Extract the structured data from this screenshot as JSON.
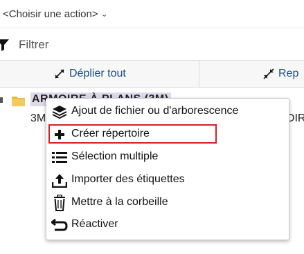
{
  "action_select": {
    "label": "<Choisir une action>"
  },
  "filter": {
    "placeholder": "Filtrer"
  },
  "tree_toolbar": {
    "expand_label": "Déplier tout",
    "collapse_label": "Rep"
  },
  "tree": {
    "node_label": "ARMOIRE À PLANS (3M)",
    "sub_left": "3M",
    "sub_right": "OIR"
  },
  "context_menu": {
    "items": [
      {
        "label": "Ajout de fichier ou d'arborescence",
        "icon": "layers-icon"
      },
      {
        "label": "Créer répertoire",
        "icon": "plus-icon",
        "highlighted": true,
        "highlight_color": "#d41f26"
      },
      {
        "label": "Sélection multiple",
        "icon": "list-icon"
      },
      {
        "label": "Importer des étiquettes",
        "icon": "upload-icon"
      },
      {
        "label": "Mettre à la corbeille",
        "icon": "trash-icon"
      },
      {
        "label": "Réactiver",
        "icon": "undo-icon"
      }
    ]
  },
  "colors": {
    "link": "#1a4e86",
    "highlight_border": "#d41f26",
    "selection_bg": "#ddd8ea"
  }
}
